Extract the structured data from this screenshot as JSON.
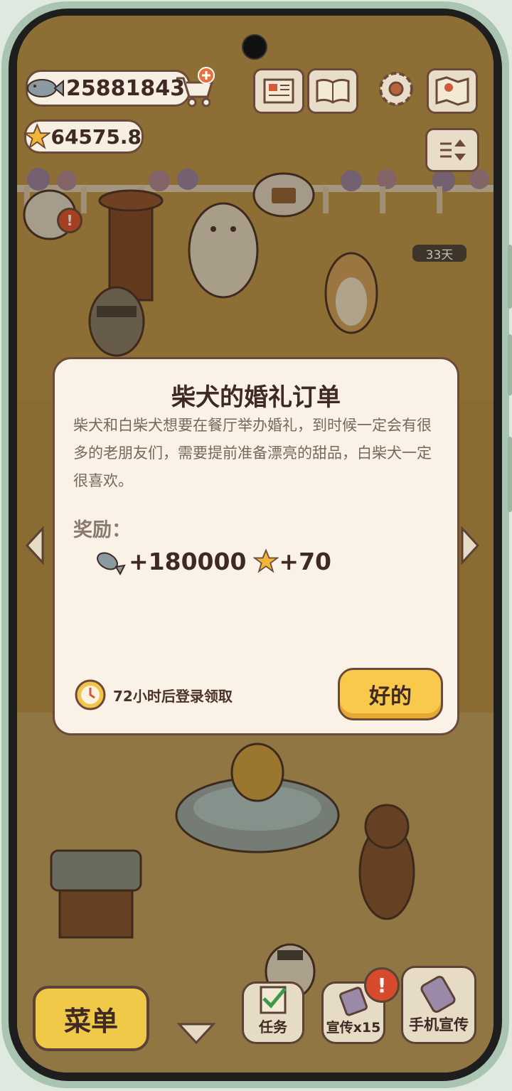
{
  "hud": {
    "fish_amount": "25881843",
    "star_amount": "64575.8"
  },
  "scene": {
    "days_badge": "33天"
  },
  "modal": {
    "title": "柴犬的婚礼订单",
    "description": "柴犬和白柴犬想要在餐厅举办婚礼，到时候一定会有很多的老朋友们，需要提前准备漂亮的甜品，白柴犬一定很喜欢。",
    "reward_label": "奖励：",
    "fish_reward": "+180000",
    "star_reward": "+70",
    "timer_text": "72小时后登录领取",
    "ok_label": "好的"
  },
  "bottom_bar": {
    "menu_label": "菜单",
    "task_label": "任务",
    "promo_label": "宣传x15",
    "phone_promo_label": "手机宣传"
  },
  "colors": {
    "accent_yellow": "#f8c94a",
    "outline_brown": "#6b4a3a",
    "modal_bg": "#faf2e6",
    "alert_red": "#d74b2c"
  }
}
